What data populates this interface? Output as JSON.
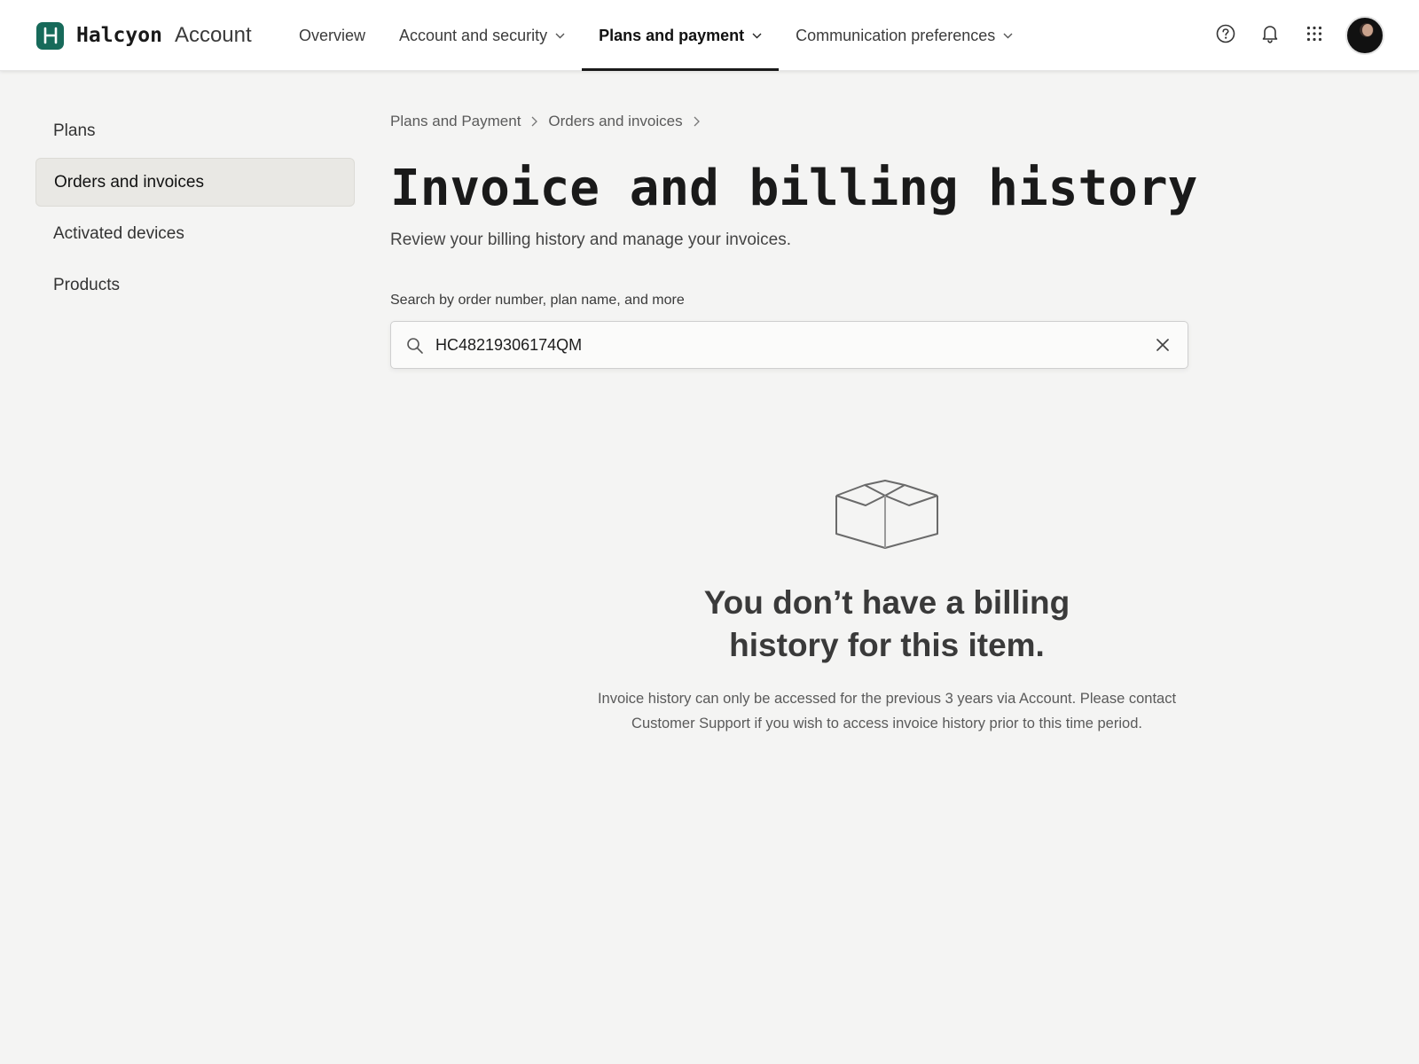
{
  "brand": {
    "name": "Halcyon",
    "suffix": "Account",
    "logo_letter": "H",
    "logo_color": "#176a5a"
  },
  "nav": {
    "items": [
      {
        "label": "Overview",
        "has_dropdown": false,
        "active": false
      },
      {
        "label": "Account and security",
        "has_dropdown": true,
        "active": false
      },
      {
        "label": "Plans and payment",
        "has_dropdown": true,
        "active": true
      },
      {
        "label": "Communication preferences",
        "has_dropdown": true,
        "active": false
      }
    ]
  },
  "top_actions": {
    "icons": [
      "help-icon",
      "bell-icon",
      "app-launcher-icon",
      "avatar"
    ]
  },
  "sidebar": {
    "items": [
      {
        "label": "Plans",
        "active": false
      },
      {
        "label": "Orders and invoices",
        "active": true
      },
      {
        "label": "Activated devices",
        "active": false
      },
      {
        "label": "Products",
        "active": false
      }
    ]
  },
  "breadcrumb": [
    "Plans and Payment",
    "Orders and invoices"
  ],
  "page": {
    "title": "Invoice and billing history",
    "subtitle": "Review your billing history and manage your invoices."
  },
  "search": {
    "label": "Search by order number, plan name, and more",
    "value": "HC48219306174QM"
  },
  "empty_state": {
    "icon": "box-icon",
    "title_line1": "You don’t have a billing",
    "title_line2": "history for this item.",
    "description": "Invoice history can only be accessed for the previous 3 years via Account. Please contact Customer Support if you wish to access invoice history prior to this time period."
  }
}
